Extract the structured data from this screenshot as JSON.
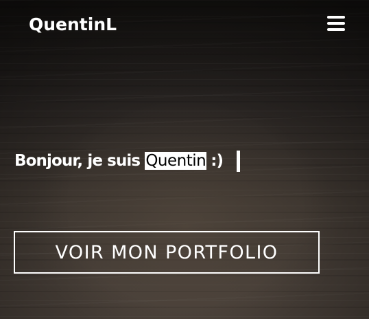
{
  "header": {
    "brand": "QuentinL",
    "menu_icon": "hamburger-menu-icon"
  },
  "hero": {
    "greeting_prefix": "Bonjour, je suis",
    "highlighted_name": "Quentin",
    "greeting_suffix": ":)",
    "cta_label": "VOIR MON PORTFOLIO"
  },
  "colors": {
    "text": "#ffffff",
    "highlight_background": "#ffffff",
    "highlight_text": "#000000",
    "background_dark": "#1e1b19"
  }
}
